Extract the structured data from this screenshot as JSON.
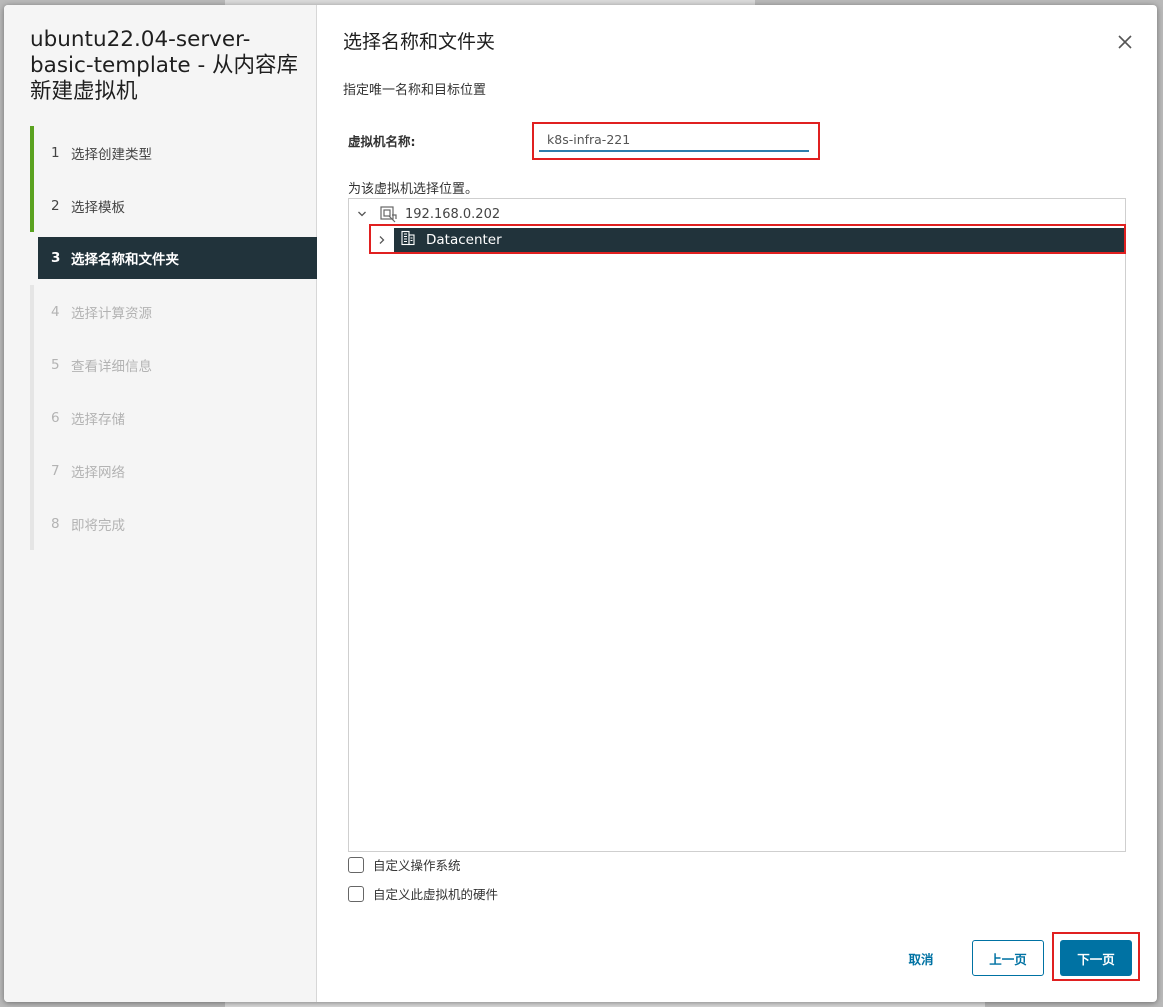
{
  "wizard": {
    "title": "ubuntu22.04-server-basic-template - 从内容库新建虚拟机",
    "steps": [
      {
        "num": "1",
        "label": "选择创建类型",
        "state": "done"
      },
      {
        "num": "2",
        "label": "选择模板",
        "state": "done"
      },
      {
        "num": "3",
        "label": "选择名称和文件夹",
        "state": "active"
      },
      {
        "num": "4",
        "label": "选择计算资源",
        "state": "pending"
      },
      {
        "num": "5",
        "label": "查看详细信息",
        "state": "pending"
      },
      {
        "num": "6",
        "label": "选择存储",
        "state": "pending"
      },
      {
        "num": "7",
        "label": "选择网络",
        "state": "pending"
      },
      {
        "num": "8",
        "label": "即将完成",
        "state": "pending"
      }
    ]
  },
  "page": {
    "title": "选择名称和文件夹",
    "subtitle": "指定唯一名称和目标位置",
    "close_icon": "close-icon"
  },
  "form": {
    "vm_name_label": "虚拟机名称:",
    "vm_name_value": "k8s-infra-221",
    "location_label": "为该虚拟机选择位置。"
  },
  "tree": {
    "root": {
      "label": "192.168.0.202",
      "icon": "vcenter-icon",
      "expanded": true
    },
    "children": [
      {
        "label": "Datacenter",
        "icon": "datacenter-icon",
        "selected": true,
        "expanded": false
      }
    ]
  },
  "options": {
    "customize_os": "自定义操作系统",
    "customize_hw": "自定义此虚拟机的硬件"
  },
  "footer": {
    "cancel": "取消",
    "back": "上一页",
    "next": "下一页"
  },
  "colors": {
    "accent": "#0072a3",
    "selected_bg": "#21333b",
    "done_step": "#5aa220",
    "highlight_box": "#e02020"
  }
}
